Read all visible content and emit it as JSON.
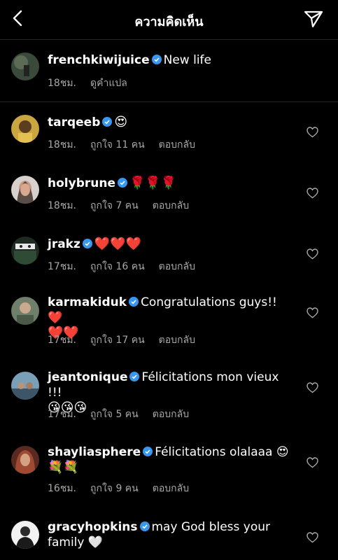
{
  "header": {
    "title": "ความคิดเห็น",
    "back_icon": "chevron-left-icon",
    "share_icon": "paper-plane-icon"
  },
  "caption": {
    "username": "frenchkiwijuice",
    "text": "New life",
    "time": "18ชม.",
    "translate_label": "ดูคำแปล"
  },
  "comments": [
    {
      "username": "tarqeeb",
      "text": "😍",
      "line2": "",
      "time": "18ชม.",
      "likes": "ถูกใจ 11 คน",
      "reply": "ตอบกลับ"
    },
    {
      "username": "holybrune",
      "text": "🌹🌹🌹",
      "line2": "",
      "time": "18ชม.",
      "likes": "ถูกใจ 7 คน",
      "reply": "ตอบกลับ"
    },
    {
      "username": "jrakz",
      "text": "❤️❤️❤️",
      "line2": "",
      "time": "17ชม.",
      "likes": "ถูกใจ 16 คน",
      "reply": "ตอบกลับ"
    },
    {
      "username": "karmakiduk",
      "text": "Congratulations guys!! ❤️",
      "line2": "❤️❤️",
      "time": "17ชม.",
      "likes": "ถูกใจ 17 คน",
      "reply": "ตอบกลับ"
    },
    {
      "username": "jeantonique",
      "text": "Félicitations mon vieux !!!",
      "line2": "😘😘😘",
      "time": "17ชม.",
      "likes": "ถูกใจ 5 คน",
      "reply": "ตอบกลับ"
    },
    {
      "username": "shayliasphere",
      "text": "Félicitations olalaaa 😍",
      "line2": "💐💐",
      "time": "16ชม.",
      "likes": "ถูกใจ 9 คน",
      "reply": "ตอบกลับ"
    },
    {
      "username": "gracyhopkins",
      "text": "may God bless your",
      "line2": "family 🤍",
      "time": "",
      "likes": "",
      "reply": ""
    }
  ],
  "colors": {
    "background": "#000000",
    "text": "#ffffff",
    "secondary_text": "#a8a8a8",
    "verified_blue": "#3897f0",
    "divider": "#262626"
  }
}
